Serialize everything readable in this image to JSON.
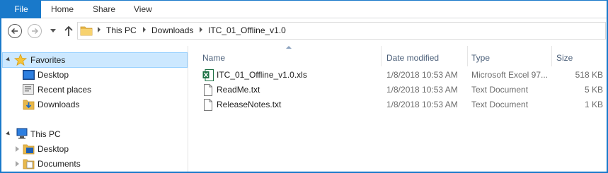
{
  "ribbon": {
    "file_tab": "File",
    "tabs": [
      "Home",
      "Share",
      "View"
    ]
  },
  "address": {
    "crumbs": [
      "This PC",
      "Downloads",
      "ITC_01_Offline_v1.0"
    ]
  },
  "navpane": {
    "favorites_label": "Favorites",
    "favorites": [
      "Desktop",
      "Recent places",
      "Downloads"
    ],
    "thispc_label": "This PC",
    "thispc_children": [
      "Desktop",
      "Documents"
    ]
  },
  "filelist": {
    "columns": {
      "name": "Name",
      "date": "Date modified",
      "type": "Type",
      "size": "Size"
    },
    "rows": [
      {
        "name": "ITC_01_Offline_v1.0.xls",
        "date": "1/8/2018 10:53 AM",
        "type": "Microsoft Excel 97...",
        "size": "518 KB",
        "icon": "excel-file-icon"
      },
      {
        "name": "ReadMe.txt",
        "date": "1/8/2018 10:53 AM",
        "type": "Text Document",
        "size": "5 KB",
        "icon": "text-file-icon"
      },
      {
        "name": "ReleaseNotes.txt",
        "date": "1/8/2018 10:53 AM",
        "type": "Text Document",
        "size": "1 KB",
        "icon": "text-file-icon"
      }
    ]
  },
  "colors": {
    "accent": "#1979ca",
    "selection": "#cce8ff",
    "header_text": "#4c607a"
  }
}
